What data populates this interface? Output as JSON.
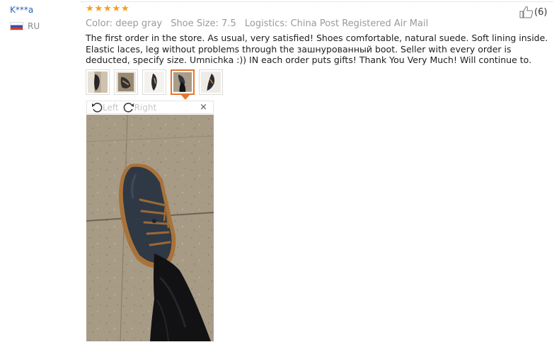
{
  "user": {
    "name": "K***a",
    "country": "RU"
  },
  "review": {
    "rating": 5,
    "star_glyph": "★",
    "color_attr": "Color: deep gray",
    "size_attr": "Shoe Size: 7.5",
    "logistics_attr": "Logistics: China Post Registered Air Mail",
    "text": "The first order in the store. As usual, very satisfied! Shoes comfortable, natural suede. Soft lining inside. Elastic laces, leg without problems through the зашнурованный boot. Seller with every order is deducted, specify size. Umnichka :)) IN each order puts gifts! Thank You Very Much! Will continue to."
  },
  "helpful": {
    "count_text": "(6)"
  },
  "thumbnails": {
    "count": 5,
    "active_index": 3
  },
  "viewer": {
    "rotate_left_label": "Left",
    "rotate_right_label": "Right",
    "close_label": "×"
  },
  "colors": {
    "accent": "#e8762b",
    "star": "#f89d1e",
    "link": "#2a62b8"
  }
}
